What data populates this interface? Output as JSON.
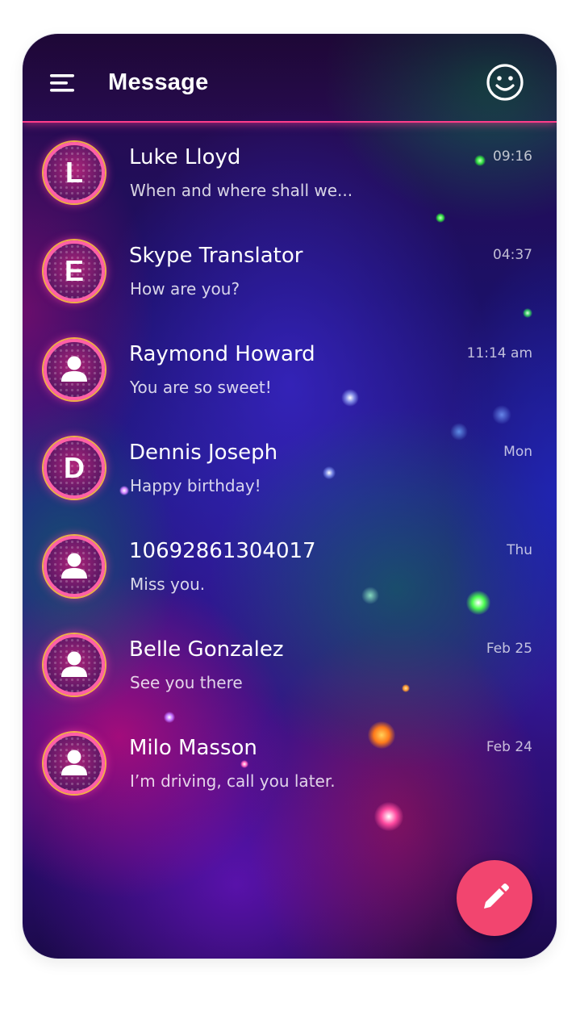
{
  "header": {
    "title": "Message",
    "menu_icon": "hamburger-menu-icon",
    "right_icon": "smiley-face-icon"
  },
  "conversations": [
    {
      "name": "Luke Lloyd",
      "preview": "When and where shall we...",
      "time": "09:16",
      "avatar": "L"
    },
    {
      "name": "Skype Translator",
      "preview": "How are you?",
      "time": "04:37",
      "avatar": "E"
    },
    {
      "name": "Raymond Howard",
      "preview": "You are so sweet!",
      "time": "11:14 am",
      "avatar": ""
    },
    {
      "name": "Dennis Joseph",
      "preview": "Happy birthday!",
      "time": "Mon",
      "avatar": "D"
    },
    {
      "name": "10692861304017",
      "preview": "Miss you.",
      "time": "Thu",
      "avatar": ""
    },
    {
      "name": "Belle Gonzalez",
      "preview": "See you there",
      "time": "Feb 25",
      "avatar": ""
    },
    {
      "name": "Milo Masson",
      "preview": "I’m driving, call you later.",
      "time": "Feb 24",
      "avatar": ""
    }
  ],
  "fab": {
    "icon": "pencil-compose-icon"
  },
  "colors": {
    "accent": "#f2456f",
    "header_line": "#ff3d8a",
    "avatar_ring": "#ff5fa8"
  }
}
